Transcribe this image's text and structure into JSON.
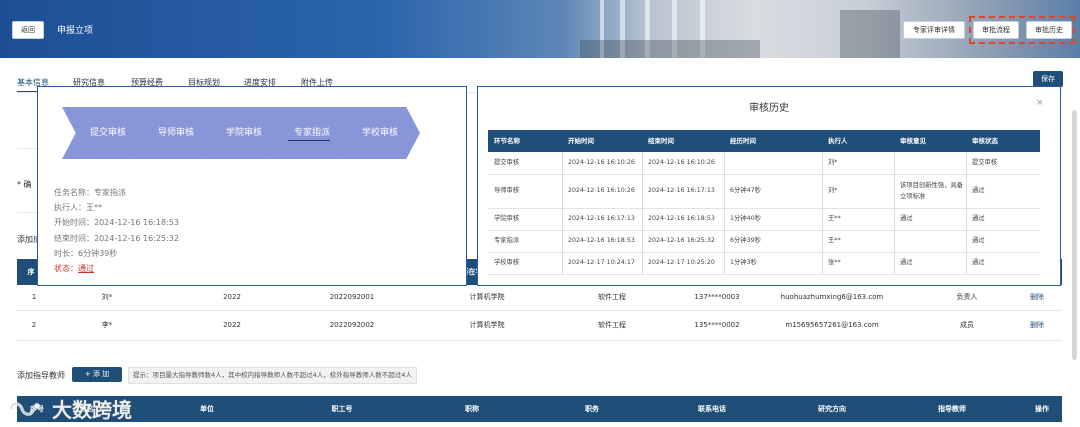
{
  "header": {
    "back_label": "返回",
    "title": "申报立项",
    "buttons": [
      "专家评审详情",
      "审批流程",
      "审批历史"
    ]
  },
  "tabs": [
    "基本信息",
    "研究信息",
    "预算经费",
    "目标规划",
    "进度安排",
    "附件上传"
  ],
  "save_label": "保存",
  "background_labels": {
    "confirm_prefix": "* 确",
    "add_member_prefix": "添加成",
    "add_teacher_label": "添加指导教师",
    "seq_prefix": "序"
  },
  "members": {
    "header_fragment": "所在学",
    "rows": [
      {
        "seq": "1",
        "name": "刘*",
        "grade": "2022",
        "student_id": "2022092001",
        "college": "计算机学院",
        "major": "软件工程",
        "phone": "137****0003",
        "email": "huohuazhumxing6@163.com",
        "role": "负责人",
        "action": "删除"
      },
      {
        "seq": "2",
        "name": "李*",
        "grade": "2022",
        "student_id": "2022092002",
        "college": "计算机学院",
        "major": "软件工程",
        "phone": "135****0002",
        "email": "m15695657261@163.com",
        "role": "成员",
        "action": "删除"
      }
    ]
  },
  "add_teacher": {
    "button_label": "+ 添 加",
    "hint": "提示：项目最大指导教师数4人，其中校内指导教师人数不超过4人，校外指导教师人数不超过4人"
  },
  "teacher_table": {
    "headers": [
      "序号",
      "姓名",
      "单位",
      "职工号",
      "职称",
      "职务",
      "联系电话",
      "研究方向",
      "指导教师",
      "操作"
    ]
  },
  "flow": {
    "steps": [
      "提交审核",
      "导师审核",
      "学院审核",
      "专家指派",
      "学校审核"
    ],
    "current_index": 3,
    "task": {
      "name": "任务名称：专家指派",
      "executor": "执行人：王**",
      "start": "开始时间：2024-12-16 16:18:53",
      "end": "结束时间：2024-12-16 16:25:32",
      "duration": "时长：6分钟39秒",
      "status_prefix": "状态：",
      "status_value": "通过"
    }
  },
  "history": {
    "title": "审核历史",
    "close": "×",
    "headers": [
      "环节名称",
      "开始时间",
      "结束时间",
      "经历时间",
      "执行人",
      "审核意见",
      "审核状态"
    ],
    "rows": [
      [
        "提交审核",
        "2024-12-16 16:10:26",
        "2024-12-16 16:10:26",
        "",
        "刘*",
        "",
        "提交审核"
      ],
      [
        "导师审核",
        "2024-12-16 16:10:26",
        "2024-12-16 16:17:13",
        "6分钟47秒",
        "刘*",
        "该项目创新性强，具备立项标准",
        "通过"
      ],
      [
        "学院审核",
        "2024-12-16 16:17:13",
        "2024-12-16 16:18:53",
        "1分钟40秒",
        "王**",
        "通过",
        "通过"
      ],
      [
        "专家指派",
        "2024-12-16 16:18:53",
        "2024-12-16 16:25:32",
        "6分钟39秒",
        "王**",
        "",
        "通过"
      ],
      [
        "学校审核",
        "2024-12-17 10:24:17",
        "2024-12-17 10:25:20",
        "1分钟3秒",
        "张**",
        "通过",
        "通过"
      ]
    ]
  },
  "watermark": "大数跨境",
  "colors": {
    "primary": "#1f4e79",
    "flow_arrow": "#8895d8",
    "highlight": "#e1442c",
    "status": "#c0392b"
  }
}
